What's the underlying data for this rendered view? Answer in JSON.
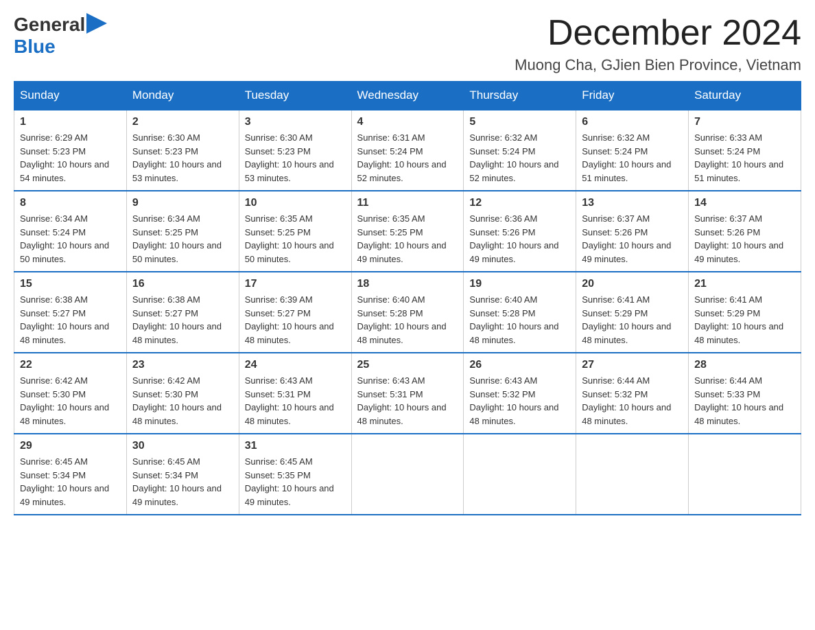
{
  "header": {
    "logo_general": "General",
    "logo_blue": "Blue",
    "month_title": "December 2024",
    "location": "Muong Cha, GJien Bien Province, Vietnam"
  },
  "days_of_week": [
    "Sunday",
    "Monday",
    "Tuesday",
    "Wednesday",
    "Thursday",
    "Friday",
    "Saturday"
  ],
  "weeks": [
    [
      {
        "day": "1",
        "sunrise": "6:29 AM",
        "sunset": "5:23 PM",
        "daylight": "10 hours and 54 minutes."
      },
      {
        "day": "2",
        "sunrise": "6:30 AM",
        "sunset": "5:23 PM",
        "daylight": "10 hours and 53 minutes."
      },
      {
        "day": "3",
        "sunrise": "6:30 AM",
        "sunset": "5:23 PM",
        "daylight": "10 hours and 53 minutes."
      },
      {
        "day": "4",
        "sunrise": "6:31 AM",
        "sunset": "5:24 PM",
        "daylight": "10 hours and 52 minutes."
      },
      {
        "day": "5",
        "sunrise": "6:32 AM",
        "sunset": "5:24 PM",
        "daylight": "10 hours and 52 minutes."
      },
      {
        "day": "6",
        "sunrise": "6:32 AM",
        "sunset": "5:24 PM",
        "daylight": "10 hours and 51 minutes."
      },
      {
        "day": "7",
        "sunrise": "6:33 AM",
        "sunset": "5:24 PM",
        "daylight": "10 hours and 51 minutes."
      }
    ],
    [
      {
        "day": "8",
        "sunrise": "6:34 AM",
        "sunset": "5:24 PM",
        "daylight": "10 hours and 50 minutes."
      },
      {
        "day": "9",
        "sunrise": "6:34 AM",
        "sunset": "5:25 PM",
        "daylight": "10 hours and 50 minutes."
      },
      {
        "day": "10",
        "sunrise": "6:35 AM",
        "sunset": "5:25 PM",
        "daylight": "10 hours and 50 minutes."
      },
      {
        "day": "11",
        "sunrise": "6:35 AM",
        "sunset": "5:25 PM",
        "daylight": "10 hours and 49 minutes."
      },
      {
        "day": "12",
        "sunrise": "6:36 AM",
        "sunset": "5:26 PM",
        "daylight": "10 hours and 49 minutes."
      },
      {
        "day": "13",
        "sunrise": "6:37 AM",
        "sunset": "5:26 PM",
        "daylight": "10 hours and 49 minutes."
      },
      {
        "day": "14",
        "sunrise": "6:37 AM",
        "sunset": "5:26 PM",
        "daylight": "10 hours and 49 minutes."
      }
    ],
    [
      {
        "day": "15",
        "sunrise": "6:38 AM",
        "sunset": "5:27 PM",
        "daylight": "10 hours and 48 minutes."
      },
      {
        "day": "16",
        "sunrise": "6:38 AM",
        "sunset": "5:27 PM",
        "daylight": "10 hours and 48 minutes."
      },
      {
        "day": "17",
        "sunrise": "6:39 AM",
        "sunset": "5:27 PM",
        "daylight": "10 hours and 48 minutes."
      },
      {
        "day": "18",
        "sunrise": "6:40 AM",
        "sunset": "5:28 PM",
        "daylight": "10 hours and 48 minutes."
      },
      {
        "day": "19",
        "sunrise": "6:40 AM",
        "sunset": "5:28 PM",
        "daylight": "10 hours and 48 minutes."
      },
      {
        "day": "20",
        "sunrise": "6:41 AM",
        "sunset": "5:29 PM",
        "daylight": "10 hours and 48 minutes."
      },
      {
        "day": "21",
        "sunrise": "6:41 AM",
        "sunset": "5:29 PM",
        "daylight": "10 hours and 48 minutes."
      }
    ],
    [
      {
        "day": "22",
        "sunrise": "6:42 AM",
        "sunset": "5:30 PM",
        "daylight": "10 hours and 48 minutes."
      },
      {
        "day": "23",
        "sunrise": "6:42 AM",
        "sunset": "5:30 PM",
        "daylight": "10 hours and 48 minutes."
      },
      {
        "day": "24",
        "sunrise": "6:43 AM",
        "sunset": "5:31 PM",
        "daylight": "10 hours and 48 minutes."
      },
      {
        "day": "25",
        "sunrise": "6:43 AM",
        "sunset": "5:31 PM",
        "daylight": "10 hours and 48 minutes."
      },
      {
        "day": "26",
        "sunrise": "6:43 AM",
        "sunset": "5:32 PM",
        "daylight": "10 hours and 48 minutes."
      },
      {
        "day": "27",
        "sunrise": "6:44 AM",
        "sunset": "5:32 PM",
        "daylight": "10 hours and 48 minutes."
      },
      {
        "day": "28",
        "sunrise": "6:44 AM",
        "sunset": "5:33 PM",
        "daylight": "10 hours and 48 minutes."
      }
    ],
    [
      {
        "day": "29",
        "sunrise": "6:45 AM",
        "sunset": "5:34 PM",
        "daylight": "10 hours and 49 minutes."
      },
      {
        "day": "30",
        "sunrise": "6:45 AM",
        "sunset": "5:34 PM",
        "daylight": "10 hours and 49 minutes."
      },
      {
        "day": "31",
        "sunrise": "6:45 AM",
        "sunset": "5:35 PM",
        "daylight": "10 hours and 49 minutes."
      },
      null,
      null,
      null,
      null
    ]
  ]
}
